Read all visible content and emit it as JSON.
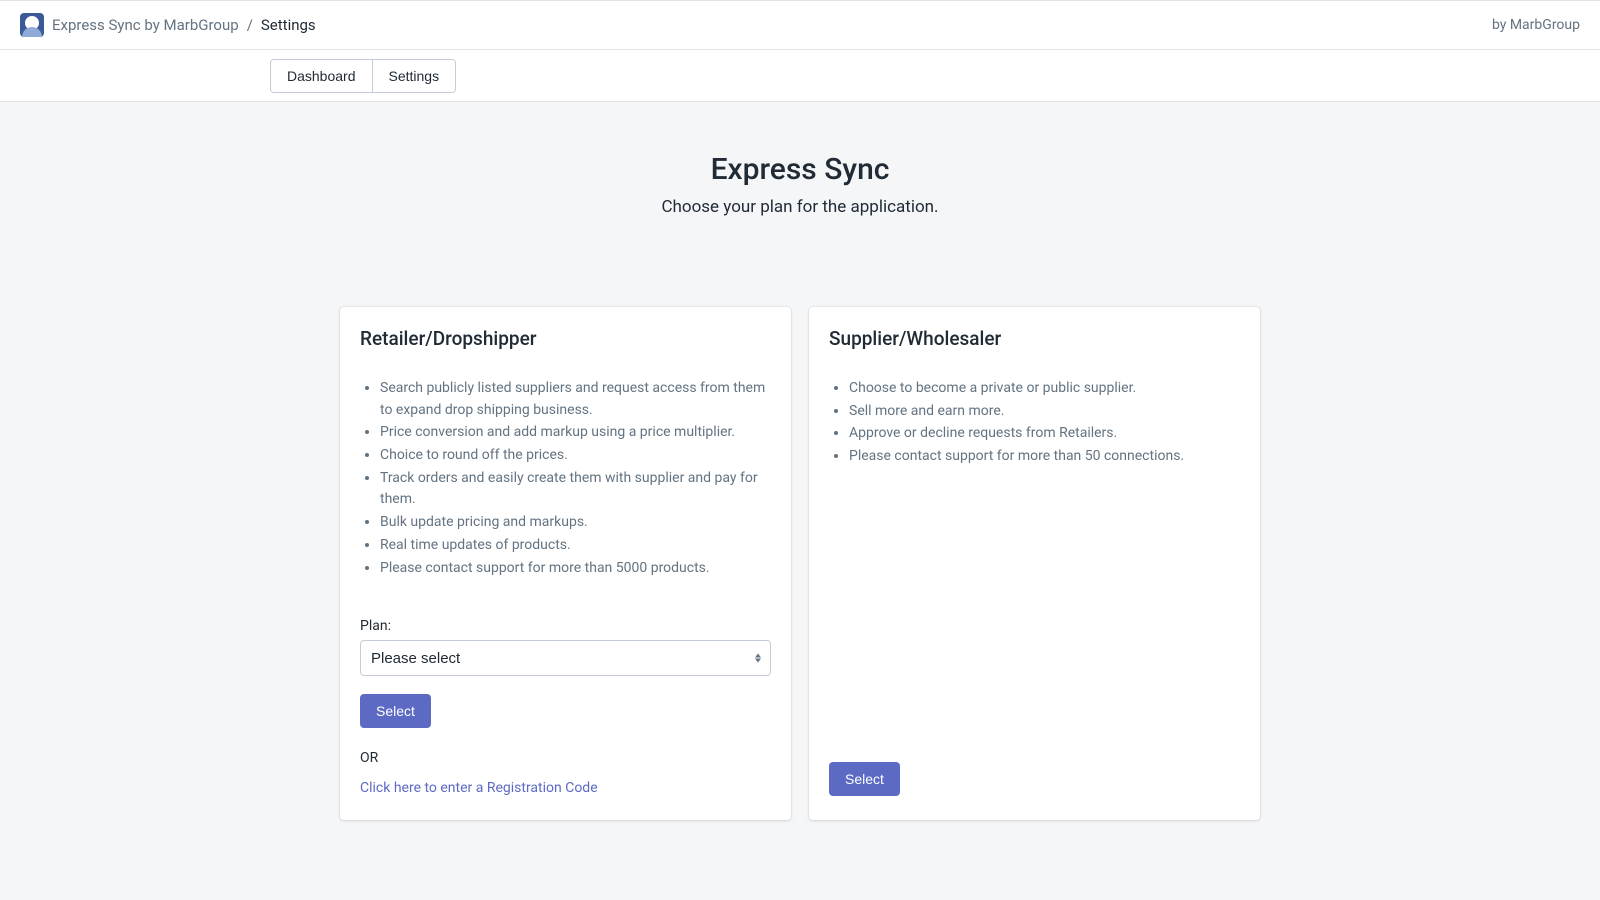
{
  "header": {
    "app_name": "Express Sync by MarbGroup",
    "breadcrumb_page": "Settings",
    "byline": "by MarbGroup"
  },
  "tabs": {
    "dashboard": "Dashboard",
    "settings": "Settings"
  },
  "hero": {
    "title": "Express Sync",
    "subtitle": "Choose your plan for the application."
  },
  "cards": {
    "retailer": {
      "title": "Retailer/Dropshipper",
      "features": [
        "Search publicly listed suppliers and request access from them to expand drop shipping business.",
        "Price conversion and add markup using a price multiplier.",
        "Choice to round off the prices.",
        "Track orders and easily create them with supplier and pay for them.",
        "Bulk update pricing and markups.",
        "Real time updates of products.",
        "Please contact support for more than 5000 products."
      ],
      "plan_label": "Plan:",
      "plan_placeholder": "Please select",
      "select_button": "Select",
      "or_text": "OR",
      "registration_link": "Click here to enter a Registration Code"
    },
    "supplier": {
      "title": "Supplier/Wholesaler",
      "features": [
        "Choose to become a private or public supplier.",
        "Sell more and earn more.",
        "Approve or decline requests from Retailers.",
        "Please contact support for more than 50 connections."
      ],
      "select_button": "Select"
    }
  }
}
